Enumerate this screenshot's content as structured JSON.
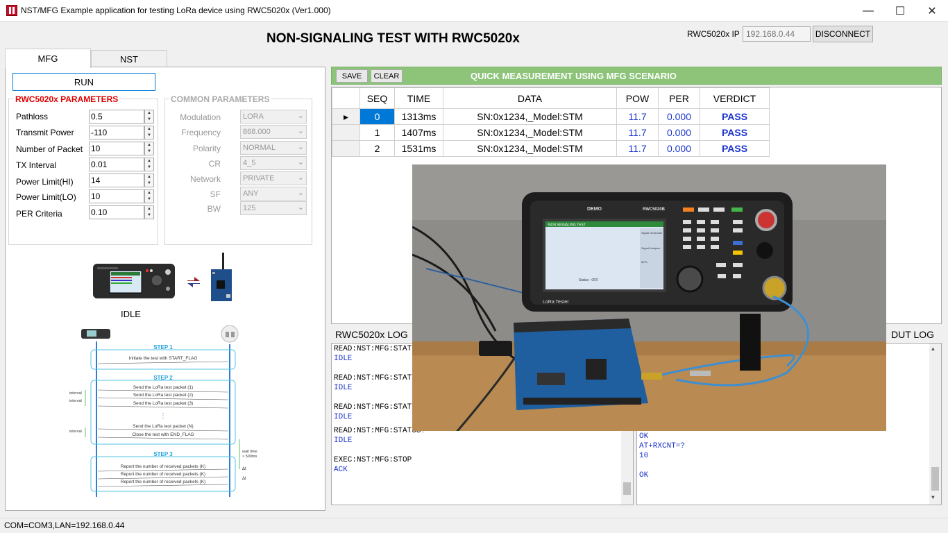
{
  "window": {
    "title": "NST/MFG Example application for testing LoRa device using RWC5020x (Ver1.000)",
    "minimize": "—",
    "maximize": "☐",
    "close": "✕"
  },
  "header": {
    "title": "NON-SIGNALING TEST WITH RWC5020x",
    "ip_label": "RWC5020x IP",
    "ip_value": "192.168.0.44",
    "disconnect_label": "DISCONNECT"
  },
  "tabs": [
    {
      "label": "MFG",
      "active": true
    },
    {
      "label": "NST",
      "active": false
    }
  ],
  "left": {
    "run_label": "RUN",
    "rwc_params_title": "RWC5020x PARAMETERS",
    "common_params_title": "COMMON PARAMETERS",
    "rwc_params": [
      {
        "label": "Pathloss",
        "value": "0.5"
      },
      {
        "label": "Transmit Power",
        "value": "-110"
      },
      {
        "label": "Number of Packet",
        "value": "10"
      },
      {
        "label": "TX Interval",
        "value": "0.01"
      },
      {
        "label": "Power Limit(HI)",
        "value": "14"
      },
      {
        "label": "Power Limit(LO)",
        "value": "10"
      },
      {
        "label": "PER Criteria",
        "value": "0.10"
      }
    ],
    "common_params": [
      {
        "label": "Modulation",
        "value": "LORA"
      },
      {
        "label": "Frequency",
        "value": "868.000"
      },
      {
        "label": "Polarity",
        "value": "NORMAL"
      },
      {
        "label": "CR",
        "value": "4_5"
      },
      {
        "label": "Network",
        "value": "PRIVATE"
      },
      {
        "label": "SF",
        "value": "ANY"
      },
      {
        "label": "BW",
        "value": "125"
      }
    ],
    "status": "IDLE",
    "diagram": {
      "step1": "STEP 1",
      "step1_msg": "Initiate the test with START_FLAG",
      "step2": "STEP 2",
      "step2_msgs": [
        "Send the LoRa test packet (1)",
        "Send the LoRa test packet (2)",
        "Send the LoRa test packet (3)",
        "Send the LoRa test packet (N)",
        "Close the test with END_FLAG"
      ],
      "interval": "interval",
      "dots": "⋮",
      "step3": "STEP 3",
      "step3_msg": "Report the number of received packets (K)",
      "wait_time": "wait time",
      "wait_value": "> 500ms",
      "delta": "Δt"
    }
  },
  "right": {
    "save_label": "SAVE",
    "clear_label": "CLEAR",
    "toolbar_title": "QUICK MEASUREMENT USING MFG SCENARIO",
    "toolbar_color": "#8dc47a",
    "table_headers": [
      "SEQ",
      "TIME",
      "DATA",
      "POW",
      "PER",
      "VERDICT"
    ],
    "rows": [
      {
        "indicator": "▸",
        "seq": "0",
        "time": "1313ms",
        "data": "SN:0x1234,_Model:STM",
        "pow": "11.7",
        "per": "0.000",
        "verdict": "PASS"
      },
      {
        "indicator": "",
        "seq": "1",
        "time": "1407ms",
        "data": "SN:0x1234,_Model:STM",
        "pow": "11.7",
        "per": "0.000",
        "verdict": "PASS"
      },
      {
        "indicator": "",
        "seq": "2",
        "time": "1531ms",
        "data": "SN:0x1234,_Model:STM",
        "pow": "11.7",
        "per": "0.000",
        "verdict": "PASS"
      }
    ],
    "rwc_log_label": "RWC5020x LOG",
    "dut_log_label": "DUT LOG",
    "rwc_log": [
      {
        "text": "READ:NST:MFG:STATUS?",
        "kind": "cmd"
      },
      {
        "text": "IDLE",
        "kind": "resp"
      },
      {
        "text": "",
        "kind": "cmd"
      },
      {
        "text": "READ:NST:MFG:STATUS?",
        "kind": "cmd"
      },
      {
        "text": "IDLE",
        "kind": "resp"
      },
      {
        "text": "",
        "kind": "cmd"
      },
      {
        "text": "READ:NST:MFG:STATUS?",
        "kind": "cmd"
      },
      {
        "text": "IDLE",
        "kind": "resp"
      },
      {
        "text": "",
        "kind": "cmd"
      },
      {
        "text": "READ:NST:MFG:STATUS?",
        "kind": "cmd"
      },
      {
        "text": "IDLE",
        "kind": "resp"
      },
      {
        "text": "",
        "kind": "cmd"
      },
      {
        "text": "EXEC:NST:MFG:STOP",
        "kind": "cmd"
      },
      {
        "text": "ACK",
        "kind": "resp"
      }
    ],
    "dut_log": [
      {
        "text": "OK",
        "kind": "resp"
      },
      {
        "text": "AT+RXCNT=?",
        "kind": "resp"
      },
      {
        "text": "10",
        "kind": "resp"
      },
      {
        "text": "",
        "kind": "resp"
      },
      {
        "text": "OK",
        "kind": "resp"
      }
    ],
    "photo": {
      "brand": "DEMO",
      "model": "RWC5020B",
      "screen_title": "NON SIGNALING TEST",
      "status": "Status : OFF",
      "tester_label": "LoRa Tester",
      "menu": [
        "Signal Generator",
        "Signal Analyzer",
        "MFG"
      ]
    }
  },
  "statusbar": {
    "text": "COM=COM3,LAN=192.168.0.44"
  }
}
